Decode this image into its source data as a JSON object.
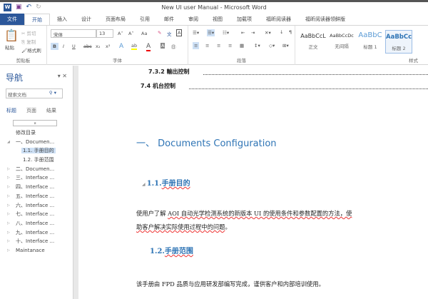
{
  "window": {
    "title": "New UI user Manual - Microsoft Word"
  },
  "tabs": [
    "文件",
    "开始",
    "插入",
    "设计",
    "页面布局",
    "引用",
    "邮件",
    "审阅",
    "视图",
    "加载项",
    "福昕阅读器",
    "福昕阅读器领鲜版"
  ],
  "ribbon": {
    "clipboard": {
      "paste": "粘贴",
      "cut": "剪切",
      "copy": "复制",
      "format_painter": "格式刷",
      "label": "剪贴板"
    },
    "font": {
      "name": "宋体",
      "size": "13",
      "label": "字体",
      "bold": "B",
      "italic": "I",
      "underline": "U",
      "strike": "abc",
      "sub": "x₂",
      "sup": "x²",
      "grow": "A˄",
      "shrink": "A˅",
      "case": "Aa"
    },
    "paragraph": {
      "label": "段落"
    },
    "styles": {
      "label": "样式",
      "items": [
        {
          "preview": "AaBbCcL",
          "name": "正文"
        },
        {
          "preview": "AaBbCcDc",
          "name": "无间隔"
        },
        {
          "preview": "AaBbC",
          "name": "标题 1"
        },
        {
          "preview": "AaBbCc",
          "name": "标题 2"
        }
      ]
    }
  },
  "nav": {
    "title": "导航",
    "search_placeholder": "搜索文档",
    "tabs": [
      "标题",
      "页面",
      "结果"
    ],
    "items": [
      {
        "label": "修改目录"
      },
      {
        "label": "一、Documen..."
      },
      {
        "label": "1.1. 手册目的"
      },
      {
        "label": "1.2. 手册范围"
      },
      {
        "label": "二、Documen..."
      },
      {
        "label": "三、Interface ..."
      },
      {
        "label": "四、Interface ..."
      },
      {
        "label": "五、Interface ..."
      },
      {
        "label": "六、Interface ..."
      },
      {
        "label": "七、Interface ..."
      },
      {
        "label": "八、Interface ..."
      },
      {
        "label": "九、Interface ..."
      },
      {
        "label": "十、Interface ..."
      },
      {
        "label": "Maintanace"
      }
    ]
  },
  "doc": {
    "toc": [
      {
        "label": "7.3.2 輸出控制"
      },
      {
        "label": "7.4 机台控制"
      }
    ],
    "heading1": "一、 Documents Configuration",
    "h2a_num": "1.1.",
    "h2a_text": "手册目的",
    "p1_a": "使用户了解 ",
    "p1_b": "AOI 自动光学检测系统的新版本 UI 的使用条件和参数配置的方法，使",
    "p2": "助客户解决实际使用过程中的问题",
    "p2_end": "。",
    "h2b_num": "1.2.",
    "h2b_text": "手册范围",
    "p3": "该手册由 FPD 品质与应用研发部编写完成，谨供客户和内部培训使用。"
  }
}
